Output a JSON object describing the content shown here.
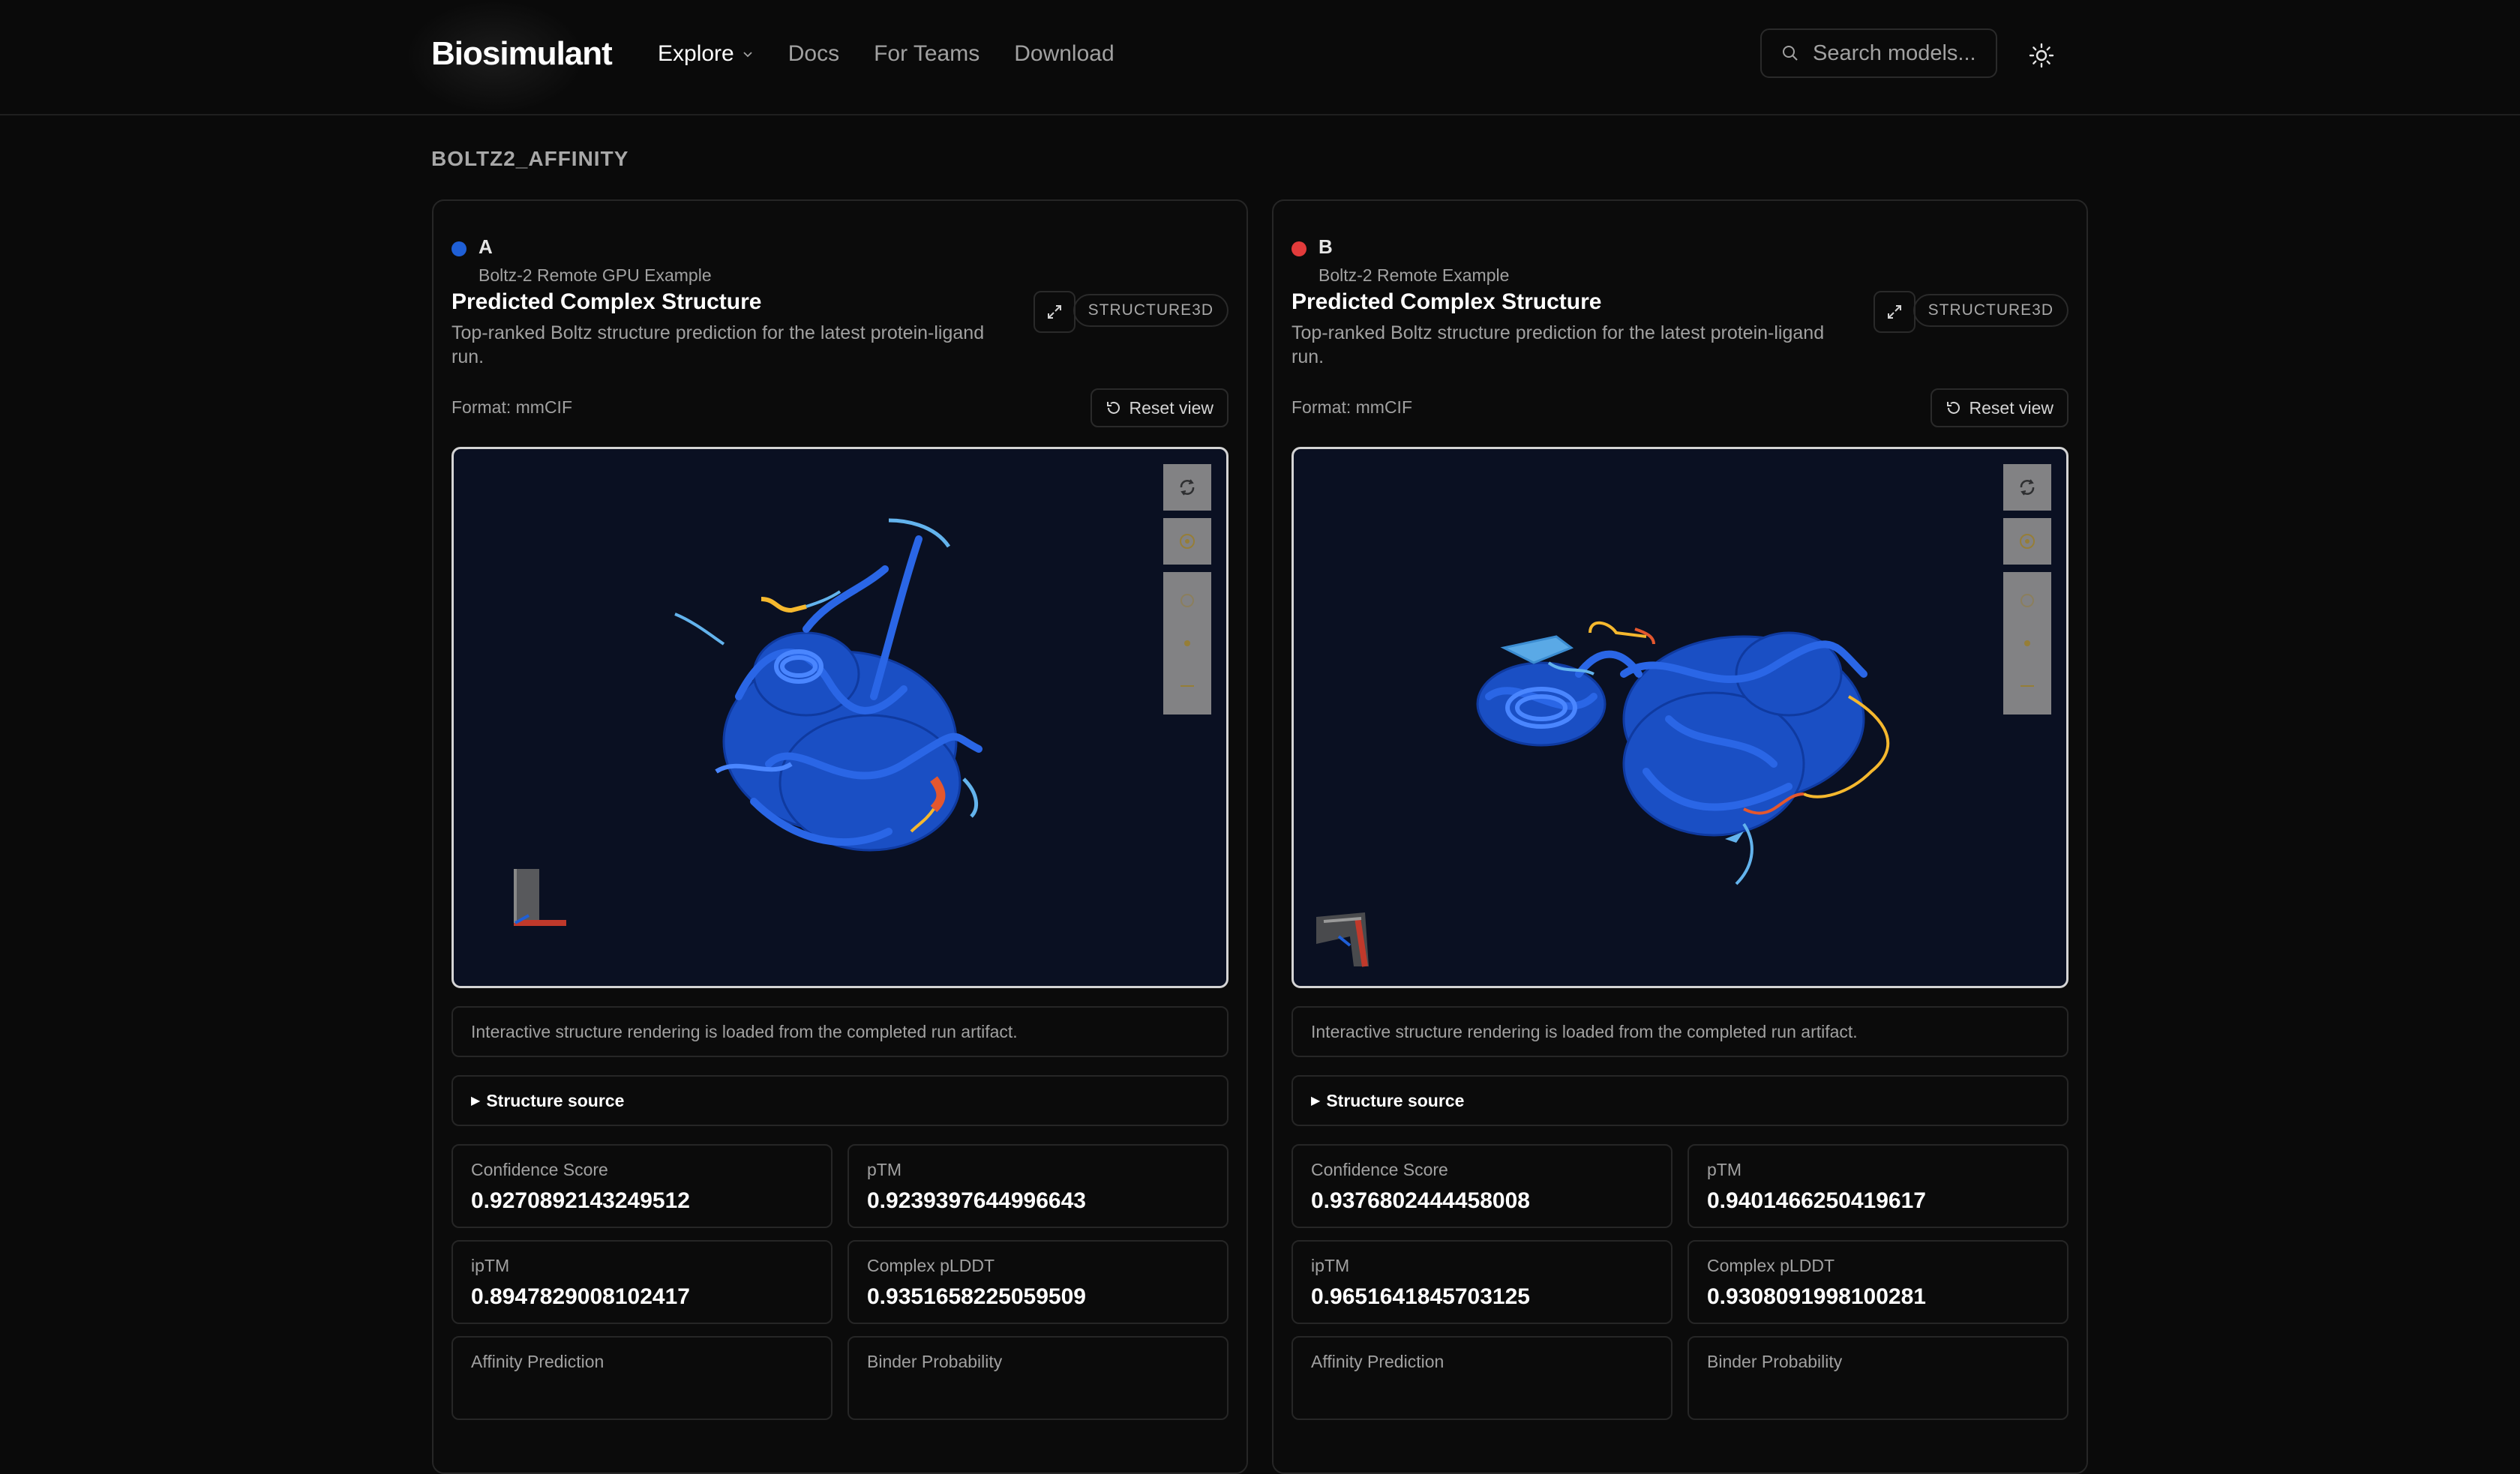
{
  "header": {
    "logo": "Biosimulant",
    "nav": [
      {
        "label": "Explore"
      },
      {
        "label": "Docs"
      },
      {
        "label": "For Teams"
      },
      {
        "label": "Download"
      }
    ],
    "search_placeholder": "Search models..."
  },
  "section_title": "BOLTZ2_AFFINITY",
  "panels": [
    {
      "letter": "A",
      "dot_color": "#1f5fd6",
      "run_name": "Boltz-2 Remote GPU Example",
      "card_title": "Predicted Complex Structure",
      "card_desc": "Top-ranked Boltz structure prediction for the latest protein-ligand run.",
      "badge": "STRUCTURE3D",
      "format": "Format: mmCIF",
      "reset_label": "Reset view",
      "note": "Interactive structure rendering is loaded from the completed run artifact.",
      "structure_source": "Structure source",
      "metrics": [
        {
          "label": "Confidence Score",
          "value": "0.9270892143249512"
        },
        {
          "label": "pTM",
          "value": "0.9239397644996643"
        },
        {
          "label": "ipTM",
          "value": "0.8947829008102417"
        },
        {
          "label": "Complex pLDDT",
          "value": "0.9351658225059509"
        },
        {
          "label": "Affinity Prediction",
          "value": ""
        },
        {
          "label": "Binder Probability",
          "value": ""
        }
      ]
    },
    {
      "letter": "B",
      "dot_color": "#e23b3b",
      "run_name": "Boltz-2 Remote Example",
      "card_title": "Predicted Complex Structure",
      "card_desc": "Top-ranked Boltz structure prediction for the latest protein-ligand run.",
      "badge": "STRUCTURE3D",
      "format": "Format: mmCIF",
      "reset_label": "Reset view",
      "note": "Interactive structure rendering is loaded from the completed run artifact.",
      "structure_source": "Structure source",
      "metrics": [
        {
          "label": "Confidence Score",
          "value": "0.9376802444458008"
        },
        {
          "label": "pTM",
          "value": "0.9401466250419617"
        },
        {
          "label": "ipTM",
          "value": "0.9651641845703125"
        },
        {
          "label": "Complex pLDDT",
          "value": "0.9308091998100281"
        },
        {
          "label": "Affinity Prediction",
          "value": ""
        },
        {
          "label": "Binder Probability",
          "value": ""
        }
      ]
    }
  ]
}
